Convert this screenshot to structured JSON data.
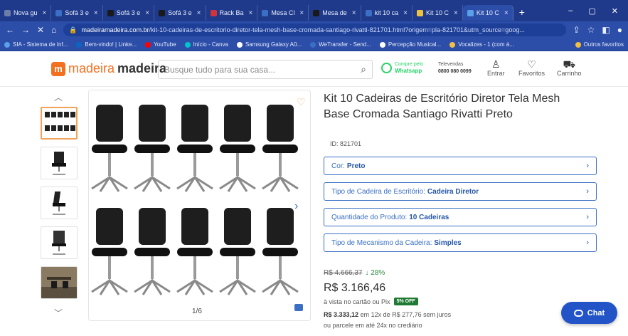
{
  "browser": {
    "tabs": [
      {
        "label": "Nova gu",
        "color": "#6c7ea8"
      },
      {
        "label": "Sofá 3 e",
        "color": "#3a6fc4"
      },
      {
        "label": "Sofá 3 e",
        "color": "#1a1a1a"
      },
      {
        "label": "Sofá 3 e",
        "color": "#1a1a1a"
      },
      {
        "label": "Rack Ba",
        "color": "#d13438"
      },
      {
        "label": "Mesa Cl",
        "color": "#3a6fc4"
      },
      {
        "label": "Mesa de",
        "color": "#1a1a1a"
      },
      {
        "label": "kit 10 ca",
        "color": "#3a6fc4"
      },
      {
        "label": "Kit 10 C",
        "color": "#f0c040"
      },
      {
        "label": "Kit 10 C",
        "color": "#5aa0e8"
      }
    ],
    "url_domain": "madeiramadeira.com.br",
    "url_path": "/kit-10-cadeiras-de-escritorio-diretor-tela-mesh-base-cromada-santiago-rivatti-821701.html?origem=pla-821701&utm_source=goog...",
    "bookmarks": [
      "SIA - Sistema de Inf...",
      "Bem-vindo! | Linke...",
      "YouTube",
      "Início - Canva",
      "Samsung Galaxy A0...",
      "WeTransfer - Send...",
      "Percepção Musical...",
      "Vocalizes - 1 (com á...",
      "Outros favoritos"
    ]
  },
  "header": {
    "logo_part1": "madeira",
    "logo_part2": "madeira",
    "search_placeholder": "Busque tudo para sua casa...",
    "whatsapp_top": "Compre pelo",
    "whatsapp_bottom": "Whatsapp",
    "televendas_label": "Televendas",
    "televendas_number": "0800 080 0099",
    "account_label": "Entrar",
    "favorites_label": "Favoritos",
    "cart_label": "Carrinho"
  },
  "gallery": {
    "counter": "1/6"
  },
  "product": {
    "title": "Kit 10 Cadeiras de Escritório Diretor Tela Mesh Base Cromada Santiago Rivatti Preto",
    "id": "ID: 821701",
    "options": [
      {
        "label": "Cor:",
        "value": "Preto"
      },
      {
        "label": "Tipo de Cadeira de Escritório:",
        "value": "Cadeira Diretor"
      },
      {
        "label": "Quantidade do Produto:",
        "value": "10 Cadeiras"
      },
      {
        "label": "Tipo de Mecanismo da Cadeira:",
        "value": "Simples"
      }
    ],
    "old_price": "R$ 4.666,37",
    "discount": "↓ 28%",
    "price": "R$ 3.166,46",
    "pay_text": "à vista no cartão ou Pix",
    "pix_badge": "5% OFF",
    "installment_total": "R$ 3.333,12",
    "installment_text": "em 12x de R$ 277,76 sem juros",
    "crediario": "ou parcele em até 24x no crediário"
  },
  "chat": {
    "label": "Chat"
  },
  "colors": {
    "brand_orange": "#f37021",
    "link_blue": "#3a6fc4",
    "chrome_blue": "#2d4ea8",
    "chat_blue": "#2354c7",
    "discount_green": "#2a8a3e"
  }
}
